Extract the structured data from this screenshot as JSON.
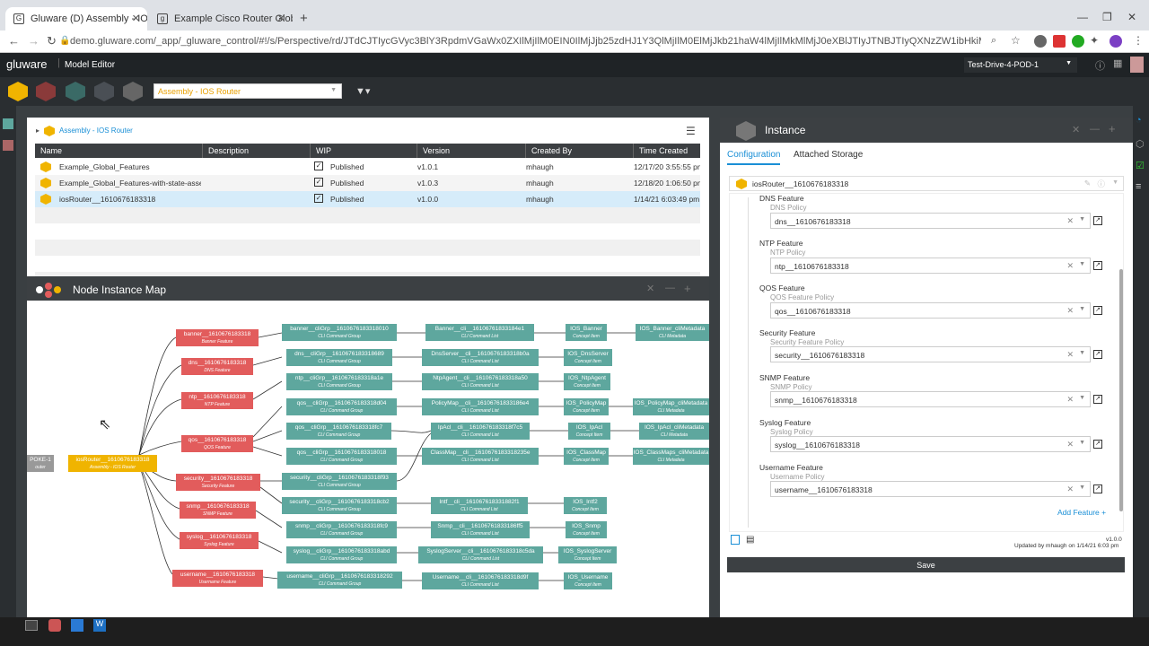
{
  "browser": {
    "tabs": [
      {
        "label": "Gluware (D) Assembly - IOS Rout",
        "favicon": "G"
      },
      {
        "label": "Example Cisco Router Global Fea",
        "favicon": "g"
      }
    ],
    "url": "demo.gluware.com/_app/_gluware_control/#!/s/Perspective/rd/JTdCJTIycGVyc3BlY3RpdmVGaWx0ZXIlMjIlM0EIN0IlMjJjb25zdHJ1Y3QlMjIlM0ElMjJkb21haW4lMjIlMkMlMjJ0eXBlJTIyJTNBJTIyQXNzZW1ibHkiMjAtJTIwSU9TJTIwUm91dGVyJTIyJTdDJ..."
  },
  "app": {
    "logo": "gluware",
    "title": "Model Editor",
    "pod_select": "Test-Drive-4-POD-1"
  },
  "toolbar": {
    "assembly_select": "Assembly - IOS Router"
  },
  "assembly_panel": {
    "breadcrumb": "Assembly - IOS Router",
    "columns": [
      "Name",
      "Description",
      "WIP",
      "Version",
      "Created By",
      "Time Created"
    ],
    "rows": [
      {
        "name": "Example_Global_Features",
        "description": "",
        "wip": "Published",
        "version": "v1.0.1",
        "created_by": "mhaugh",
        "time": "12/17/20 3:55:55 pm"
      },
      {
        "name": "Example_Global_Features-with-state-asse",
        "description": "",
        "wip": "Published",
        "version": "v1.0.3",
        "created_by": "mhaugh",
        "time": "12/18/20 1:06:50 pm"
      },
      {
        "name": "iosRouter__1610676183318",
        "description": "",
        "wip": "Published",
        "version": "v1.0.0",
        "created_by": "mhaugh",
        "time": "1/14/21 6:03:49 pm"
      }
    ]
  },
  "map": {
    "title": "Node Instance Map",
    "root": {
      "label": "iosRouter__1610676183318",
      "sub": "Assembly - IOS Router"
    },
    "spoke": {
      "label": "POKE-1",
      "sub": "outer"
    },
    "features": [
      {
        "label": "banner__1610676183318",
        "sub": "Banner Feature"
      },
      {
        "label": "dns__1610676183318",
        "sub": "DNS Feature"
      },
      {
        "label": "ntp__1610676183318",
        "sub": "NTP Feature"
      },
      {
        "label": "qos__1610676183318",
        "sub": "QOS Feature"
      },
      {
        "label": "security__1610676183318",
        "sub": "Security Feature"
      },
      {
        "label": "snmp__1610676183318",
        "sub": "SNMP Feature"
      },
      {
        "label": "syslog__1610676183318",
        "sub": "Syslog Feature"
      },
      {
        "label": "username__1610676183318",
        "sub": "Username Feature"
      }
    ],
    "groups": [
      {
        "label": "banner__cliGrp__1610676183318010",
        "sub": "CLI Command Group"
      },
      {
        "label": "dns__cliGrp__1610676183318689",
        "sub": "CLI Command Group"
      },
      {
        "label": "ntp__cliGrp__1610676183318a1e",
        "sub": "CLI Command Group"
      },
      {
        "label": "qos__cliGrp__1610676183318d04",
        "sub": "CLI Command Group"
      },
      {
        "label": "qos__cliGrp__1610676183318fc7",
        "sub": "CLI Command Group"
      },
      {
        "label": "qos__cliGrp__1610676183318018",
        "sub": "CLI Command Group"
      },
      {
        "label": "security__cliGrp__1610676183318f93",
        "sub": "CLI Command Group"
      },
      {
        "label": "security__cliGrp__1610676183318cb2",
        "sub": "CLI Command Group"
      },
      {
        "label": "snmp__cliGrp__1610676183318fc9",
        "sub": "CLI Command Group"
      },
      {
        "label": "syslog__cliGrp__1610676183318abd",
        "sub": "CLI Command Group"
      },
      {
        "label": "username__cliGrp__1610676183318292",
        "sub": "CLI Command Group"
      }
    ],
    "lists": [
      {
        "label": "Banner__cli__16106761833184e1",
        "sub": "CLI Command List"
      },
      {
        "label": "DnsServer__cli__1610676183318b0a",
        "sub": "CLI Command List"
      },
      {
        "label": "NtpAgent__cli__1610676183318a50",
        "sub": "CLI Command List"
      },
      {
        "label": "PolicyMap__cli__16106761833186e4",
        "sub": "CLI Command List"
      },
      {
        "label": "IpAcl__cli__1610676183318f7c5",
        "sub": "CLI Command List"
      },
      {
        "label": "ClassMap__cli__1610676183318235e",
        "sub": "CLI Command List"
      },
      {
        "label": "Intf__cli__161067618331882f1",
        "sub": "CLI Command List"
      },
      {
        "label": "Snmp__cli__16106761833186ff5",
        "sub": "CLI Command List"
      },
      {
        "label": "SyslogServer__cli__1610676183318c5da",
        "sub": "CLI Command List"
      },
      {
        "label": "Username__cli__1610676183318d9f",
        "sub": "CLI Command List"
      }
    ],
    "items": [
      {
        "label": "IOS_Banner",
        "sub": "Concept Item"
      },
      {
        "label": "IOS_DnsServer",
        "sub": "Concept Item"
      },
      {
        "label": "IOS_NtpAgent",
        "sub": "Concept Item"
      },
      {
        "label": "IOS_PolicyMap",
        "sub": "Concept Item"
      },
      {
        "label": "IOS_IpAcl",
        "sub": "Concept Item"
      },
      {
        "label": "IOS_ClassMap",
        "sub": "Concept Item"
      },
      {
        "label": "IOS_Intf2",
        "sub": "Concept Item"
      },
      {
        "label": "IOS_Snmp",
        "sub": "Concept Item"
      },
      {
        "label": "IOS_SyslogServer",
        "sub": "Concept Item"
      },
      {
        "label": "IOS_Username",
        "sub": "Concept Item"
      }
    ],
    "metadata": [
      {
        "label": "IOS_Banner_cliMetadata",
        "sub": "CLI Metadata"
      },
      {
        "label": "IOS_PolicyMap_cliMetadata",
        "sub": "CLI Metadata"
      },
      {
        "label": "IOS_IpAcl_cliMetadata",
        "sub": "CLI Metadata"
      },
      {
        "label": "IOS_ClassMaps_cliMetadata",
        "sub": "CLI Metadata"
      }
    ]
  },
  "instance": {
    "title": "Instance",
    "tabs": [
      "Configuration",
      "Attached Storage"
    ],
    "name": "iosRouter__1610676183318",
    "features": [
      {
        "feature": "DNS Feature",
        "policy": "DNS Policy",
        "value": "dns__1610676183318"
      },
      {
        "feature": "NTP Feature",
        "policy": "NTP Policy",
        "value": "ntp__1610676183318"
      },
      {
        "feature": "QOS Feature",
        "policy": "QOS Feature Policy",
        "value": "qos__1610676183318"
      },
      {
        "feature": "Security Feature",
        "policy": "Security Feature Policy",
        "value": "security__1610676183318"
      },
      {
        "feature": "SNMP Feature",
        "policy": "SNMP Policy",
        "value": "snmp__1610676183318"
      },
      {
        "feature": "Syslog Feature",
        "policy": "Syslog Policy",
        "value": "syslog__1610676183318"
      },
      {
        "feature": "Username Feature",
        "policy": "Username Policy",
        "value": "username__1610676183318"
      }
    ],
    "add_feature": "Add Feature +",
    "version": "v1.0.0",
    "updated": "Updated by mhaugh on 1/14/21 6:03 pm",
    "save": "Save"
  },
  "colors": {
    "feature": "#e25c5c",
    "group": "#5ea79e",
    "root": "#f0b400",
    "accent": "#1a8fd6"
  }
}
